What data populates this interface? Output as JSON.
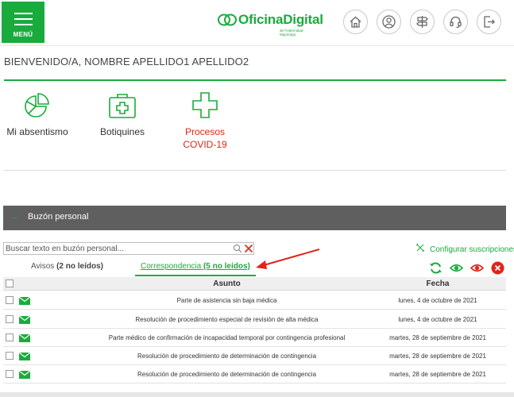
{
  "header": {
    "menu_label": "MENÚ",
    "logo_name": "OficinaDigital",
    "logo_tagline": "de Fraternidad-Muprespa",
    "brand_color": "#1aab3d",
    "icons": [
      "home-icon",
      "user-icon",
      "signpost-icon",
      "headset-icon",
      "logout-icon"
    ]
  },
  "welcome": "BIENVENIDO/A, NOMBRE APELLIDO1 APELLIDO2",
  "tiles": [
    {
      "label": "Mi absentismo",
      "icon": "pie-chart-icon"
    },
    {
      "label": "Botiquines",
      "icon": "first-aid-kit-icon"
    },
    {
      "label_line1": "Procesos",
      "label_line2": "COVID-19",
      "icon": "health-cross-icon",
      "color": "#e2231a"
    }
  ],
  "buzon": {
    "title": "Buzón personal",
    "search_placeholder": "Buscar texto en buzón personal...",
    "config_label": "Configurar suscripciones",
    "tabs": [
      {
        "label": "Avisos",
        "count": "(2 no leídos)",
        "active": false
      },
      {
        "label": "Correspondencia",
        "count": "(5 no leídos)",
        "active": true
      }
    ],
    "actions": [
      "refresh-icon",
      "mark-read-icon",
      "mark-unread-icon",
      "delete-icon"
    ],
    "columns": {
      "subject": "Asunto",
      "date": "Fecha"
    },
    "rows": [
      {
        "subject": "Parte de asistencia sin baja médica",
        "date": "lunes, 4 de octubre de 2021"
      },
      {
        "subject": "Resolución de procedimiento especial de revisión de alta médica",
        "date": "lunes, 4 de octubre de 2021"
      },
      {
        "subject": "Parte médico de confirmación de incapacidad temporal por contingencia profesional",
        "date": "martes, 28 de septiembre de 2021"
      },
      {
        "subject": "Resolución de procedimiento de determinación de contingencia",
        "date": "martes, 28 de septiembre de 2021"
      },
      {
        "subject": "Resolución de procedimiento de determinación de contingencia",
        "date": "martes, 28 de septiembre de 2021"
      }
    ]
  }
}
